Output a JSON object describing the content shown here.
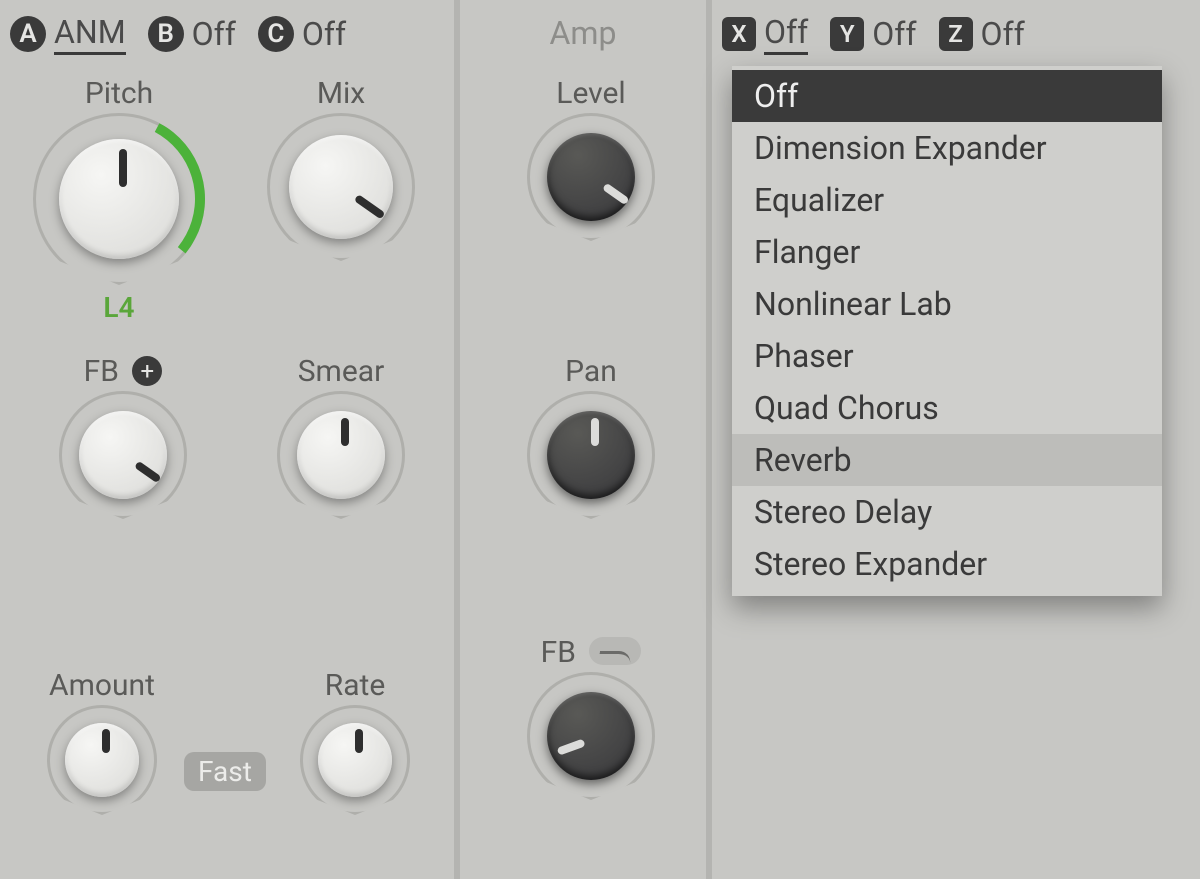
{
  "left": {
    "slots": [
      {
        "letter": "A",
        "label": "ANM",
        "active": true
      },
      {
        "letter": "B",
        "label": "Off",
        "active": false
      },
      {
        "letter": "C",
        "label": "Off",
        "active": false
      }
    ],
    "knobs": {
      "pitch": {
        "label": "Pitch",
        "angle": 0,
        "sub": "L4"
      },
      "mix": {
        "label": "Mix",
        "angle": 125
      },
      "fb": {
        "label": "FB",
        "angle": 125
      },
      "smear": {
        "label": "Smear",
        "angle": 0
      },
      "amount": {
        "label": "Amount",
        "angle": 0
      },
      "rate": {
        "label": "Rate",
        "angle": 0
      }
    },
    "pill": "Fast"
  },
  "mid": {
    "title": "Amp",
    "knobs": {
      "level": {
        "label": "Level",
        "angle": 125
      },
      "pan": {
        "label": "Pan",
        "angle": 0
      },
      "fb": {
        "label": "FB",
        "angle": -110
      }
    }
  },
  "right": {
    "slots": [
      {
        "letter": "X",
        "label": "Off",
        "active": true
      },
      {
        "letter": "Y",
        "label": "Off",
        "active": false
      },
      {
        "letter": "Z",
        "label": "Off",
        "active": false
      }
    ],
    "menu": {
      "selected": "Off",
      "hover": "Reverb",
      "items": [
        "Off",
        "Dimension Expander",
        "Equalizer",
        "Flanger",
        "Nonlinear Lab",
        "Phaser",
        "Quad Chorus",
        "Reverb",
        "Stereo Delay",
        "Stereo Expander"
      ]
    }
  }
}
